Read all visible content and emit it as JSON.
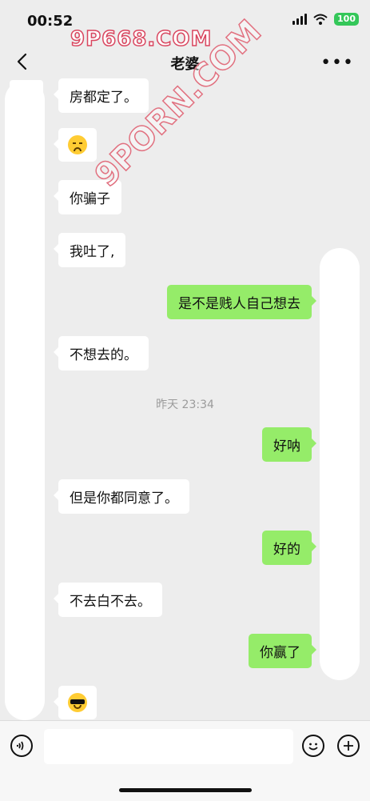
{
  "status": {
    "time": "00:52",
    "battery": "100"
  },
  "watermarks": {
    "top": "9P668.COM",
    "diagonal": "9PORN.COM"
  },
  "nav": {
    "title": "老婆",
    "more": "•••"
  },
  "messages": {
    "m1": "房都定了。",
    "m2_emoji": "sad-face-emoji",
    "m3": "你骗子",
    "m4": "我吐了,",
    "m5": "是不是贱人自己想去",
    "m6": "不想去的。",
    "timestamp": "昨天 23:34",
    "m7": "好呐",
    "m8": "但是你都同意了。",
    "m9": "好的",
    "m10": "不去白不去。",
    "m11": "你赢了",
    "m12_emoji": "sunglasses-face-emoji"
  },
  "input": {
    "placeholder": ""
  }
}
